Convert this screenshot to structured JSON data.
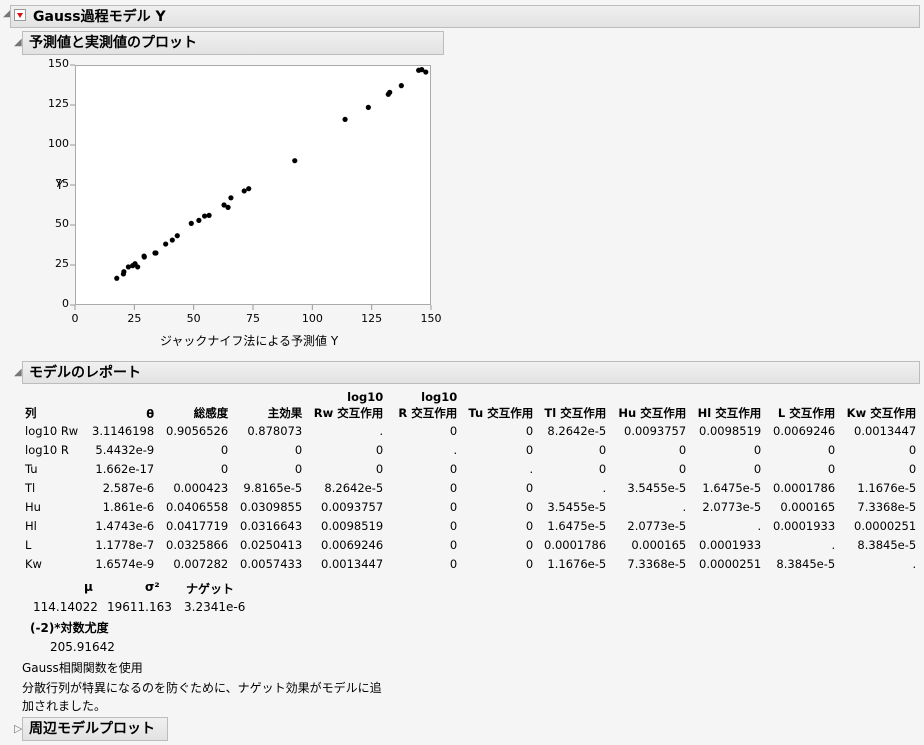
{
  "title": "Gauss過程モデル Y",
  "plot_section": {
    "title": "予測値と実測値のプロット"
  },
  "chart_data": {
    "type": "scatter",
    "xlabel": "ジャックナイフ法による予測値 Y",
    "ylabel": "Y",
    "xlim": [
      0,
      150
    ],
    "ylim": [
      0,
      150
    ],
    "xticks": [
      "0",
      "25",
      "50",
      "75",
      "100",
      "125",
      "150"
    ],
    "yticks": [
      "0",
      "25",
      "50",
      "75",
      "100",
      "125",
      "150"
    ],
    "x": [
      17.6,
      20.4,
      20.6,
      22.5,
      24.3,
      25.3,
      26.4,
      29.1,
      29.2,
      33.7,
      34.1,
      38.2,
      41.0,
      43.1,
      49.0,
      52.2,
      54.6,
      56.5,
      62.8,
      64.5,
      65.7,
      71.3,
      73.2,
      92.6,
      113.8,
      123.6,
      132.0,
      132.6,
      137.5,
      144.8,
      146.1,
      147.8
    ],
    "y": [
      16.7,
      19.4,
      20.8,
      23.8,
      24.6,
      25.8,
      23.8,
      30.6,
      30.0,
      32.5,
      32.5,
      38.1,
      40.6,
      43.3,
      51.0,
      52.9,
      55.6,
      56.0,
      62.5,
      61.0,
      67.0,
      71.3,
      72.7,
      90.2,
      116.0,
      123.5,
      131.7,
      132.9,
      137.1,
      146.7,
      147.1,
      145.6
    ]
  },
  "report": {
    "title": "モデルのレポート",
    "header_top": [
      "",
      "",
      "",
      "",
      "log10",
      "log10",
      "",
      "",
      "",
      "",
      "",
      ""
    ],
    "headers": [
      "列",
      "θ",
      "総感度",
      "主効果",
      "Rw 交互作用",
      "R 交互作用",
      "Tu 交互作用",
      "Tl 交互作用",
      "Hu 交互作用",
      "Hl 交互作用",
      "L 交互作用",
      "Kw 交互作用"
    ],
    "rows": [
      [
        "log10 Rw",
        "3.1146198",
        "0.9056526",
        "0.878073",
        ".",
        "0",
        "0",
        "8.2642e-5",
        "0.0093757",
        "0.0098519",
        "0.0069246",
        "0.0013447"
      ],
      [
        "log10 R",
        "5.4432e-9",
        "0",
        "0",
        "0",
        ".",
        "0",
        "0",
        "0",
        "0",
        "0",
        "0"
      ],
      [
        "Tu",
        "1.662e-17",
        "0",
        "0",
        "0",
        "0",
        ".",
        "0",
        "0",
        "0",
        "0",
        "0"
      ],
      [
        "Tl",
        "2.587e-6",
        "0.000423",
        "9.8165e-5",
        "8.2642e-5",
        "0",
        "0",
        ".",
        "3.5455e-5",
        "1.6475e-5",
        "0.0001786",
        "1.1676e-5"
      ],
      [
        "Hu",
        "1.861e-6",
        "0.0406558",
        "0.0309855",
        "0.0093757",
        "0",
        "0",
        "3.5455e-5",
        ".",
        "2.0773e-5",
        "0.000165",
        "7.3368e-5"
      ],
      [
        "Hl",
        "1.4743e-6",
        "0.0417719",
        "0.0316643",
        "0.0098519",
        "0",
        "0",
        "1.6475e-5",
        "2.0773e-5",
        ".",
        "0.0001933",
        "0.0000251"
      ],
      [
        "L",
        "1.1778e-7",
        "0.0325866",
        "0.0250413",
        "0.0069246",
        "0",
        "0",
        "0.0001786",
        "0.000165",
        "0.0001933",
        ".",
        "8.3845e-5"
      ],
      [
        "Kw",
        "1.6574e-9",
        "0.007282",
        "0.0057433",
        "0.0013447",
        "0",
        "0",
        "1.1676e-5",
        "7.3368e-5",
        "0.0000251",
        "8.3845e-5",
        "."
      ]
    ],
    "params": {
      "headers": [
        "μ",
        "σ²",
        "ナゲット"
      ],
      "values": [
        "114.14022",
        "19611.163",
        "3.2341e-6"
      ]
    },
    "loglik": {
      "label": "(-2)*対数尤度",
      "value": "205.91642"
    },
    "notes": [
      "Gauss相関関数を使用",
      "分散行列が特異になるのを防ぐために、ナゲット効果がモデルに追",
      "加されました。"
    ]
  },
  "marginal": {
    "title": "周辺モデルプロット"
  }
}
